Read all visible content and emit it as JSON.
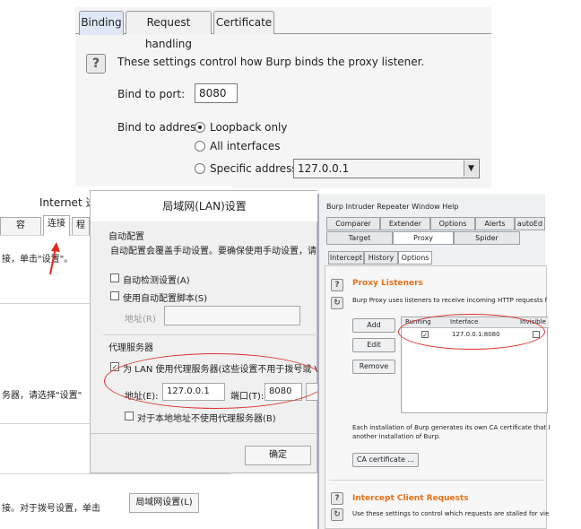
{
  "binding": {
    "tabs": [
      {
        "label": "Binding"
      },
      {
        "label": "Request handling"
      },
      {
        "label": "Certificate"
      }
    ],
    "help_glyph": "?",
    "description": "These settings control how Burp binds the proxy listener.",
    "port_label": "Bind to port:",
    "port_value": "8080",
    "address_label": "Bind to address:",
    "options": [
      {
        "label": "Loopback only"
      },
      {
        "label": "All interfaces"
      },
      {
        "label": "Specific address:"
      }
    ],
    "specific_value": "127.0.0.1",
    "selected_option": "Loopback only"
  },
  "internet_options": {
    "title": "Internet 选",
    "tabs": [
      {
        "label": "容"
      },
      {
        "label": "连接"
      },
      {
        "label": "程"
      }
    ],
    "text1": "接，单击\"设置\"。",
    "text2": "务器，请选择\"设置\"",
    "text3": "接。对于拨号设置，单击",
    "lan_button": "局域网设置(L)"
  },
  "lan_dialog": {
    "title": "局域网(LAN)设置",
    "auto_section": "自动配置",
    "auto_desc": "自动配置会覆盖手动设置。要确保使用手动设置，请禁用自动",
    "auto_detect": "自动检测设置(A)",
    "auto_script": "使用自动配置脚本(S)",
    "address_label": "地址(R)",
    "proxy_section": "代理服务器",
    "use_proxy": "为 LAN 使用代理服务器(这些设置不用于拨号或 VPN 连接",
    "proxy_addr_label": "地址(E):",
    "proxy_addr": "127.0.0.1",
    "port_label": "端口(T):",
    "port": "8080",
    "bypass_local": "对于本地地址不使用代理服务器(B)",
    "ok": "确定"
  },
  "burp": {
    "menu": "Burp Intruder Repeater Window Help",
    "top_tabs_row1": [
      {
        "label": "Comparer"
      },
      {
        "label": "Extender"
      },
      {
        "label": "Options"
      },
      {
        "label": "Alerts"
      },
      {
        "label": "autoEd"
      }
    ],
    "top_tabs_row2": [
      {
        "label": "Target"
      },
      {
        "label": "Proxy"
      },
      {
        "label": "Spider"
      }
    ],
    "sub_tabs": [
      {
        "label": "Intercept"
      },
      {
        "label": "History"
      },
      {
        "label": "Options"
      }
    ],
    "listeners_title": "Proxy Listeners",
    "listeners_desc": "Burp Proxy uses listeners to receive incoming HTTP requests f",
    "buttons": {
      "add": "Add",
      "edit": "Edit",
      "remove": "Remove"
    },
    "table_headers": {
      "running": "Running",
      "interface": "Interface",
      "invisible": "Invisible"
    },
    "row": {
      "running": "✓",
      "interface": "127.0.0.1:8080"
    },
    "ca_text1": "Each installation of Burp generates its own CA certificate that I",
    "ca_text2": "another installation of Burp.",
    "ca_button": "CA certificate ...",
    "intercept_title": "Intercept Client Requests",
    "intercept_desc": "Use these settings to control which requests are stalled for vie"
  }
}
